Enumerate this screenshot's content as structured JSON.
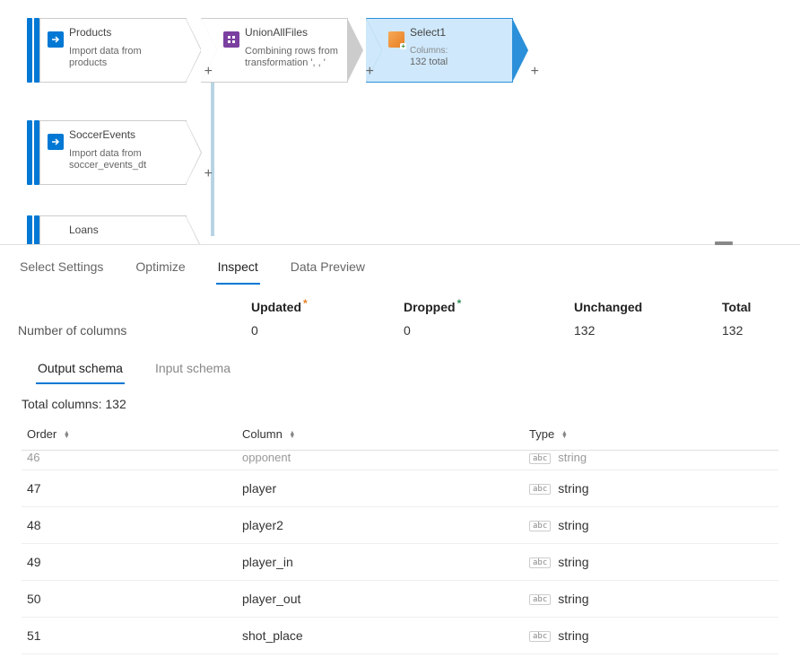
{
  "nodes": {
    "products": {
      "title": "Products",
      "desc": "Import data from products"
    },
    "soccer": {
      "title": "SoccerEvents",
      "desc": "Import data from soccer_events_dt"
    },
    "loans": {
      "title": "Loans",
      "desc": ""
    },
    "union": {
      "title": "UnionAllFiles",
      "desc": "Combining rows from transformation ', , '"
    },
    "select1": {
      "title": "Select1",
      "cols_label": "Columns:",
      "cols_value": "132 total"
    }
  },
  "tabs": {
    "select_settings": "Select Settings",
    "optimize": "Optimize",
    "inspect": "Inspect",
    "data_preview": "Data Preview"
  },
  "summary": {
    "updated_label": "Updated",
    "dropped_label": "Dropped",
    "unchanged_label": "Unchanged",
    "total_label": "Total",
    "row_label": "Number of columns",
    "updated": "0",
    "dropped": "0",
    "unchanged": "132",
    "total": "132"
  },
  "subtabs": {
    "output": "Output schema",
    "input": "Input schema"
  },
  "total_columns_label": "Total columns: 132",
  "schema": {
    "headers": {
      "order": "Order",
      "column": "Column",
      "type": "Type"
    },
    "badge": "abc",
    "rows": [
      {
        "order": "46",
        "column": "opponent",
        "type": "string",
        "cut": true
      },
      {
        "order": "47",
        "column": "player",
        "type": "string"
      },
      {
        "order": "48",
        "column": "player2",
        "type": "string"
      },
      {
        "order": "49",
        "column": "player_in",
        "type": "string"
      },
      {
        "order": "50",
        "column": "player_out",
        "type": "string"
      },
      {
        "order": "51",
        "column": "shot_place",
        "type": "string"
      }
    ]
  }
}
